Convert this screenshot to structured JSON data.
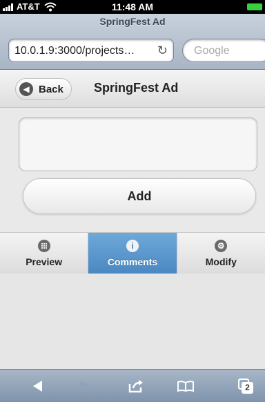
{
  "status_bar": {
    "carrier": "AT&T",
    "time": "11:48 AM"
  },
  "browser": {
    "page_title": "SpringFest Ad",
    "url": "10.0.1.9:3000/projects…",
    "search_placeholder": "Google",
    "toolbar": {
      "tabs_count": "2"
    }
  },
  "header": {
    "back_label": "Back",
    "title": "SpringFest Ad"
  },
  "form": {
    "add_label": "Add"
  },
  "tabs": [
    {
      "label": "Preview",
      "icon": "grid-icon",
      "active": false
    },
    {
      "label": "Comments",
      "icon": "info-icon",
      "active": true
    },
    {
      "label": "Modify",
      "icon": "gear-icon",
      "active": false
    }
  ],
  "colors": {
    "active_tab": "#4a88c2",
    "battery": "#35d23e"
  }
}
